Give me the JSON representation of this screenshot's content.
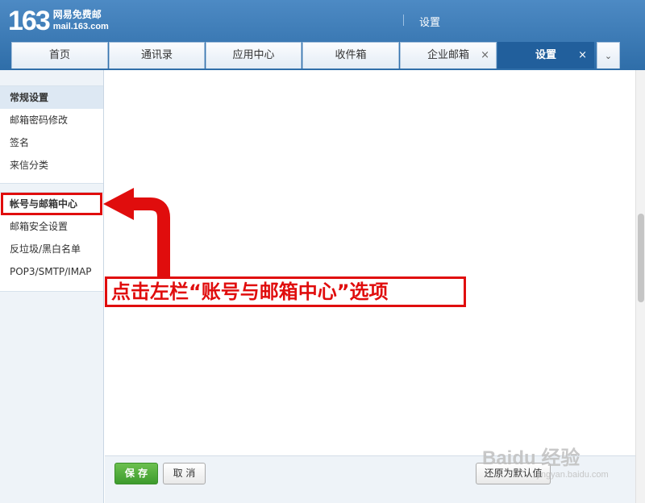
{
  "header": {
    "logo_number": "163",
    "logo_cn": "网易免费邮",
    "logo_domain": "mail.163.com",
    "page_title": "设置"
  },
  "tabs": [
    {
      "label": "首页",
      "closable": false,
      "active": false
    },
    {
      "label": "通讯录",
      "closable": false,
      "active": false
    },
    {
      "label": "应用中心",
      "closable": false,
      "active": false
    },
    {
      "label": "收件箱",
      "closable": false,
      "active": false
    },
    {
      "label": "企业邮箱",
      "closable": true,
      "active": false
    },
    {
      "label": "设置",
      "closable": true,
      "active": true
    }
  ],
  "tab_close_glyph": "×",
  "tab_more_glyph": "⌄",
  "sidebar": {
    "group1": [
      "常规设置",
      "邮箱密码修改",
      "签名",
      "来信分类"
    ],
    "group2": [
      "帐号与邮箱中心",
      "邮箱安全设置",
      "反垃圾/黑白名单",
      "POP3/SMTP/IMAP"
    ]
  },
  "footer": {
    "save": "保 存",
    "cancel": "取 消",
    "reset": "还原为默认值"
  },
  "annotation": {
    "text": "点击左栏“账号与邮箱中心”选项",
    "color": "#e00d0d"
  },
  "watermark": {
    "main": "Baidu 经验",
    "sub": "jingyan.baidu.com"
  },
  "colors": {
    "header_blue": "#2f6ea9",
    "active_tab": "#215f9c",
    "save_green": "#3d9b2d"
  }
}
